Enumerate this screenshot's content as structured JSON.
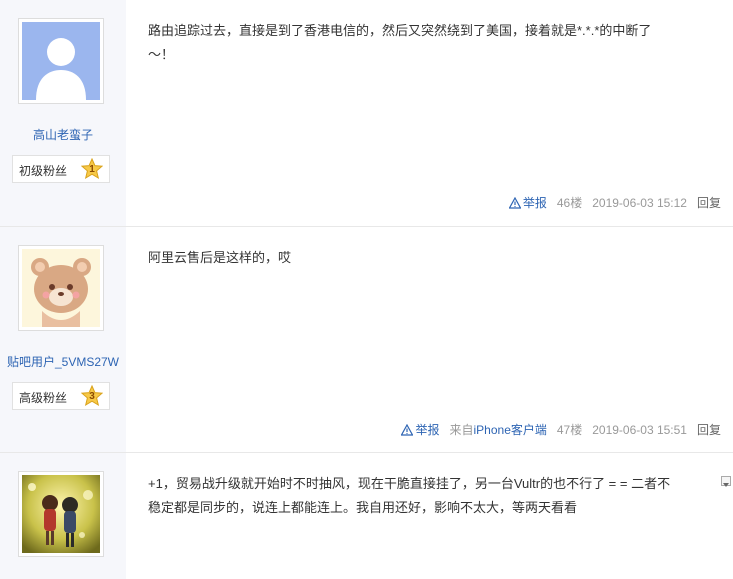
{
  "posts": [
    {
      "username": "高山老蛮子",
      "level_name": "初级粉丝",
      "level": "1",
      "content_lines": [
        "路由追踪过去，直接是到了香港电信的，然后又突然绕到了美国，接着就是*.*.*的中断了",
        "～！"
      ],
      "report_label": "举报",
      "floor": "46楼",
      "time": "2019-06-03 15:12",
      "reply_label": "回复",
      "avatar_icon": "default-user-avatar"
    },
    {
      "username": "贴吧用户_5VMS27W",
      "level_name": "高级粉丝",
      "level": "3",
      "content_lines": [
        "阿里云售后是这样的，哎"
      ],
      "report_label": "举报",
      "client_prefix": "来自",
      "client_name": "iPhone客户端",
      "floor": "47楼",
      "time": "2019-06-03 15:51",
      "reply_label": "回复",
      "avatar_icon": "bear-avatar"
    },
    {
      "content_lines": [
        "+1，贸易战升级就开始时不时抽风，现在干脆直接挂了，另一台Vultr的也不行了 = = 二者不",
        "稳定都是同步的，说连上都能连上。我自用还好，影响不太大，等两天看看"
      ],
      "avatar_icon": "anime-couple-avatar"
    }
  ],
  "colors": {
    "link": "#2d64b3",
    "sidebar_bg": "#f6f7fb",
    "meta_text": "#999999"
  }
}
